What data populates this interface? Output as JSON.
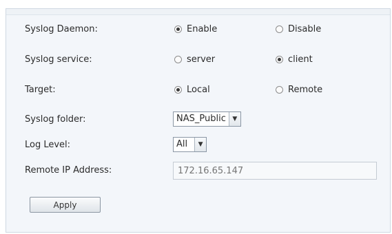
{
  "form": {
    "syslog_daemon": {
      "label": "Syslog Daemon:",
      "options": [
        {
          "label": "Enable",
          "selected": true
        },
        {
          "label": "Disable",
          "selected": false
        }
      ]
    },
    "syslog_service": {
      "label": "Syslog service:",
      "options": [
        {
          "label": "server",
          "selected": false
        },
        {
          "label": "client",
          "selected": true
        }
      ]
    },
    "target": {
      "label": "Target:",
      "options": [
        {
          "label": "Local",
          "selected": true
        },
        {
          "label": "Remote",
          "selected": false
        }
      ]
    },
    "syslog_folder": {
      "label": "Syslog folder:",
      "value": "NAS_Public"
    },
    "log_level": {
      "label": "Log Level:",
      "value": "All"
    },
    "remote_ip": {
      "label": "Remote IP Address:",
      "placeholder": "172.16.65.147"
    },
    "apply_label": "Apply"
  },
  "icons": {
    "dropdown": "chevron-down-icon",
    "radio": "radio-button-icon"
  },
  "colors": {
    "panel_background": "#f3f6fa",
    "panel_border": "#cfd8e2",
    "text": "#2b2b2b",
    "disabled_text": "#b8bfc7"
  }
}
